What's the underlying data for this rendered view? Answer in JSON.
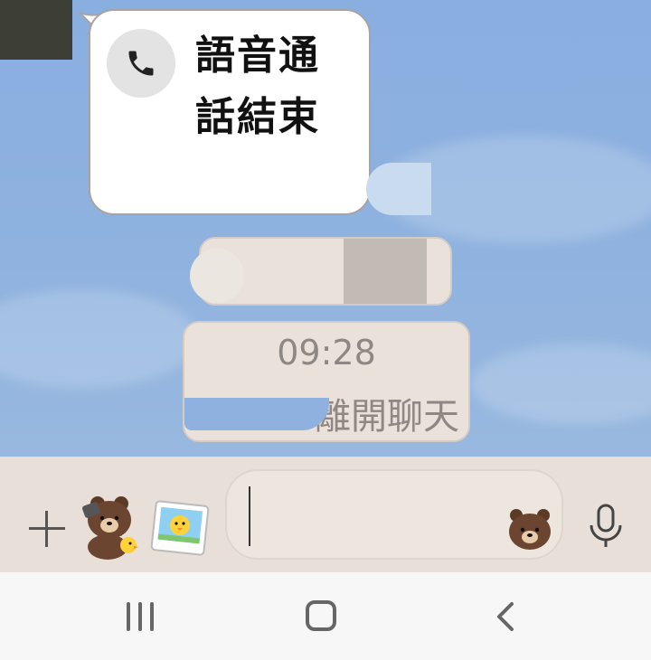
{
  "call_message": {
    "icon": "phone-icon",
    "line1": "語音通",
    "line2": "話結束"
  },
  "system_message": {
    "time": "09:28",
    "text": "離開聊天"
  },
  "input_bar": {
    "plus_icon": "plus-icon",
    "sticker_icon": "brown-bear-sticker-icon",
    "photo_icon": "sally-photo-icon",
    "text_value": "",
    "emoji_icon": "brown-bear-emoji-icon",
    "mic_icon": "microphone-icon"
  },
  "nav_bar": {
    "recent_icon": "recent-apps-icon",
    "home_icon": "home-icon",
    "back_icon": "back-icon"
  },
  "colors": {
    "chat_background": "#8fb0dc",
    "bubble": "#ffffff",
    "system_pill": "#e9e1da",
    "input_bar": "#e8e0d8",
    "nav_bar": "#f7f7f7"
  }
}
